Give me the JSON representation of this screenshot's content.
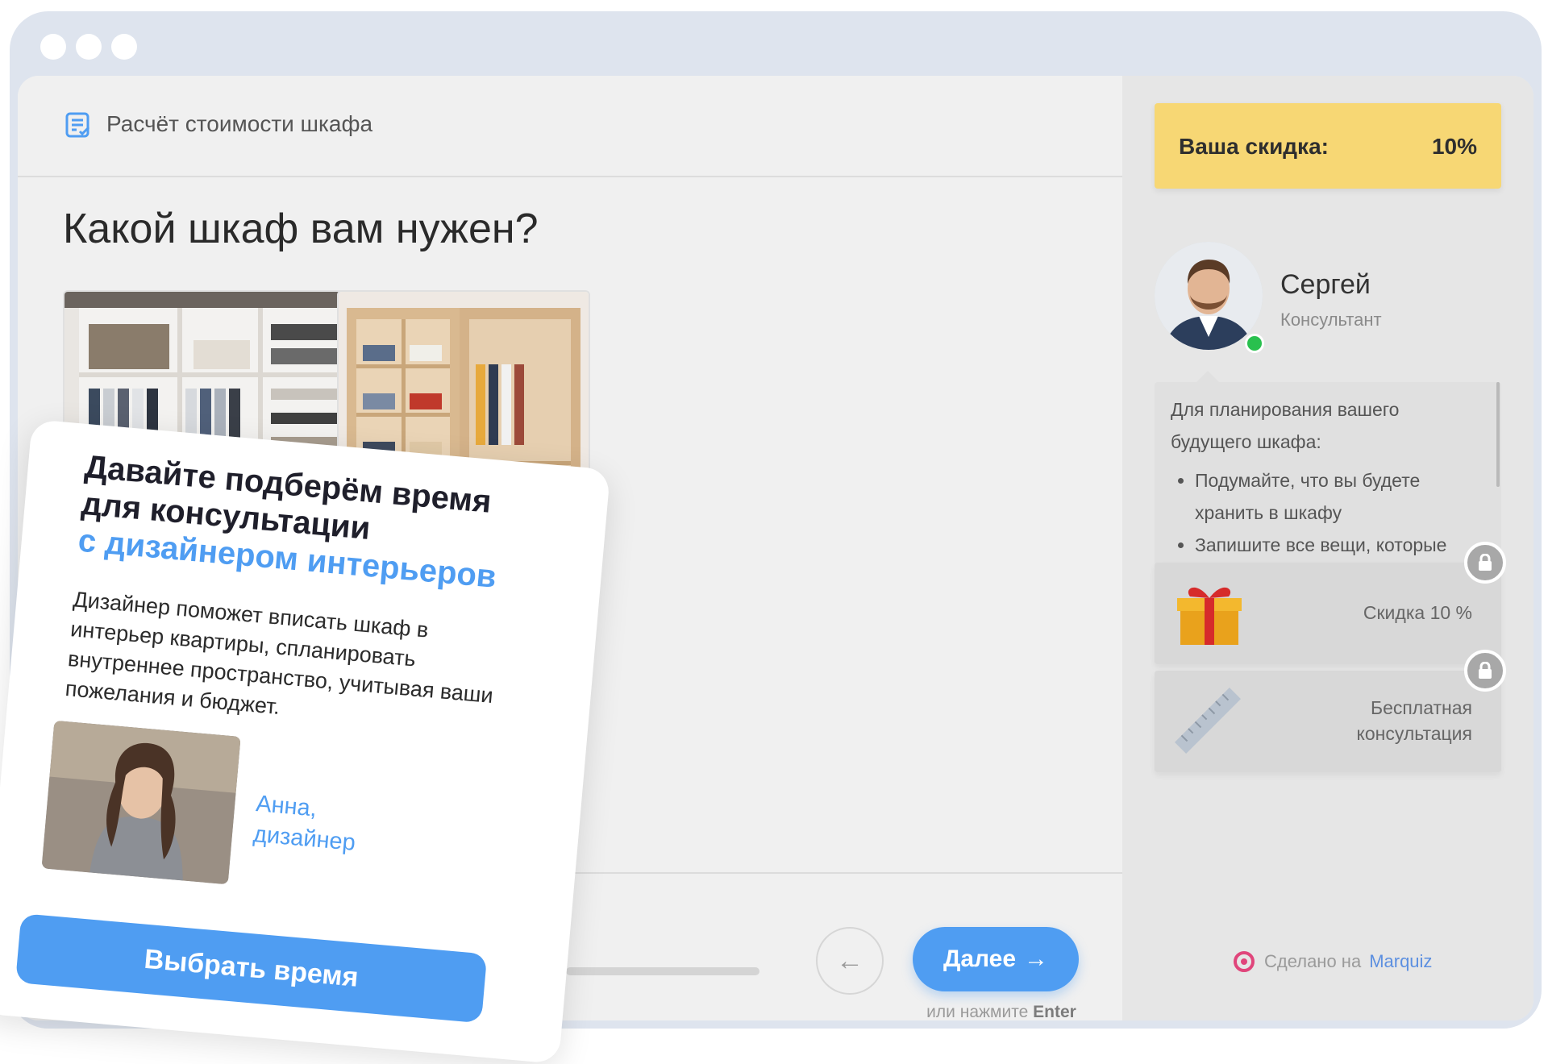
{
  "header": {
    "title": "Расчёт стоимости шкафа"
  },
  "question": "Какой шкаф вам нужен?",
  "nav": {
    "next_label": "Далее",
    "hint_prefix": "или нажмите",
    "hint_key": "Enter"
  },
  "sidebar": {
    "discount_label": "Ваша скидка:",
    "discount_value": "10%",
    "consultant_name": "Сергей",
    "consultant_role": "Консультант",
    "tip_intro": "Для планирования вашего будущего шкафа:",
    "tips": [
      "Подумайте, что вы будете хранить в шкафу",
      "Запишите все вещи, которые планируете размещать"
    ],
    "bonus1": "Скидка 10 %",
    "bonus2_line1": "Бесплатная",
    "bonus2_line2": "консультация",
    "made_prefix": "Сделано на",
    "made_brand": "Marquiz"
  },
  "promo": {
    "title_line1": "Давайте подберём время",
    "title_line2": "для консультации",
    "title_accent": "с дизайнером интерьеров",
    "description": "Дизайнер поможет вписать шкаф в интерьер квартиры, спланировать внутреннее пространство, учитывая ваши пожелания и бюджет.",
    "person_line1": "Анна,",
    "person_line2": "дизайнер",
    "button_label": "Выбрать время"
  },
  "colors": {
    "accent": "#4f9df2",
    "discount_bg": "#f7d774",
    "online": "#29c04e"
  }
}
